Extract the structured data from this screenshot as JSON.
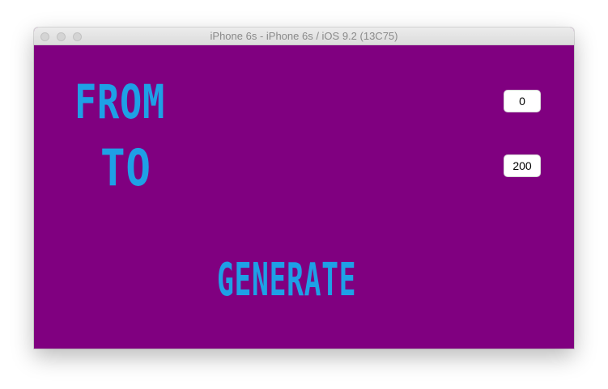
{
  "window": {
    "title": "iPhone 6s - iPhone 6s / iOS 9.2 (13C75)"
  },
  "app": {
    "from_label": "FROM",
    "to_label": "TO",
    "from_value": "0",
    "to_value": "200",
    "generate_label": "GENERATE"
  },
  "colors": {
    "background": "#800080",
    "text_accent": "#1ea0e6",
    "field_background": "#ffffff"
  }
}
